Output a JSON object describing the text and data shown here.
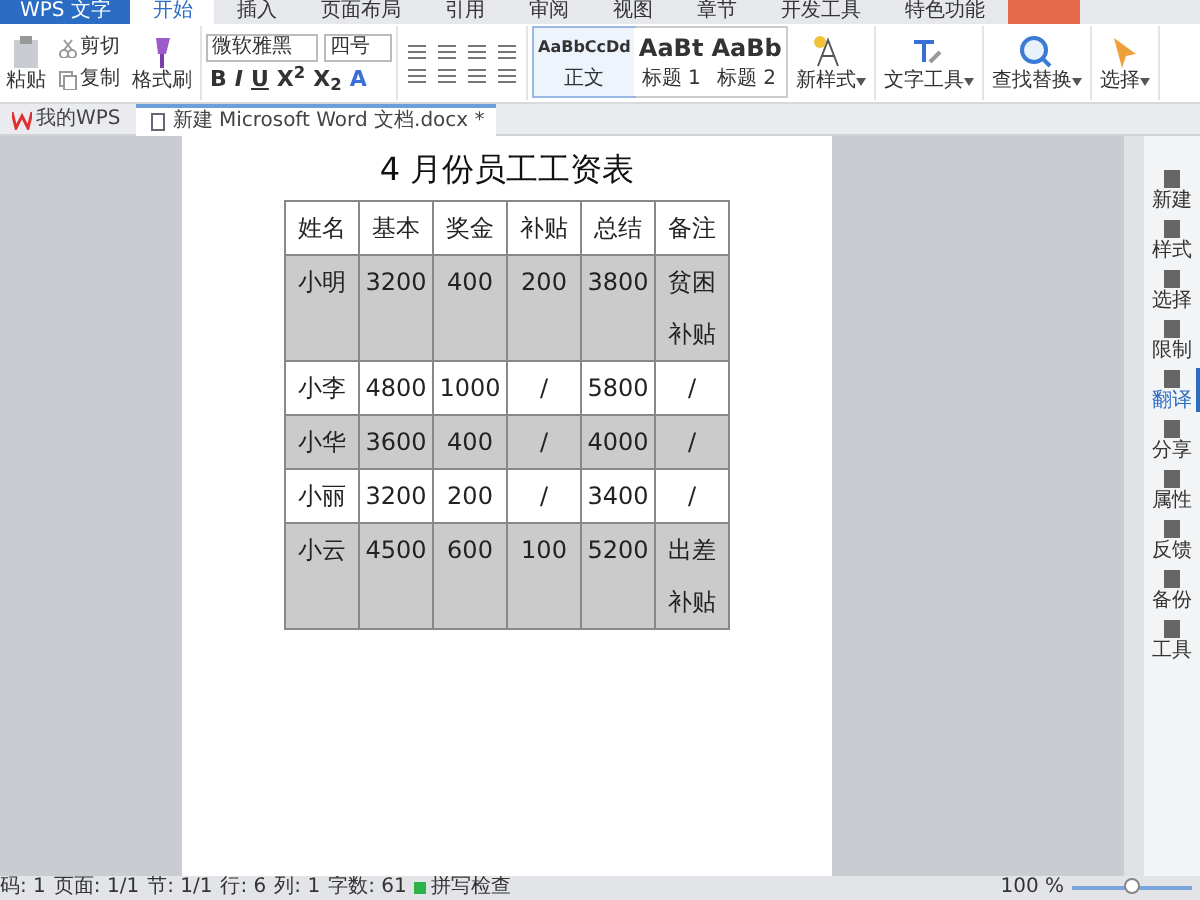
{
  "app_button": "WPS 文字",
  "menu_tabs": [
    {
      "label": "开始",
      "selected": true
    },
    {
      "label": "插入",
      "selected": false
    },
    {
      "label": "页面布局",
      "selected": false
    },
    {
      "label": "引用",
      "selected": false
    },
    {
      "label": "审阅",
      "selected": false
    },
    {
      "label": "视图",
      "selected": false
    },
    {
      "label": "章节",
      "selected": false
    },
    {
      "label": "开发工具",
      "selected": false
    },
    {
      "label": "特色功能",
      "selected": false
    }
  ],
  "ribbon": {
    "paste": "粘贴",
    "cut": "剪切",
    "copy": "复制",
    "format_painter": "格式刷",
    "font_name": "微软雅黑",
    "font_size": "四号",
    "format_buttons": [
      "B",
      "I",
      "U",
      "X$^{2}$",
      "X$_{2}$",
      "A"
    ],
    "styles": [
      {
        "preview": "AaBbCcDd",
        "label": "正文",
        "selected": true
      },
      {
        "preview": "AaBt",
        "label": "标题 1",
        "selected": false
      },
      {
        "preview": "AaBb",
        "label": "标题 2",
        "selected": false
      }
    ],
    "tools": [
      {
        "kind": "newstyle",
        "label": "新样式"
      },
      {
        "kind": "texttool",
        "label": "文字工具"
      },
      {
        "kind": "find",
        "label": "查找替换"
      },
      {
        "kind": "select",
        "label": "选择"
      }
    ]
  },
  "doc_tabs": [
    {
      "label": "我的WPS",
      "selected": false
    },
    {
      "label": "新建 Microsoft Word 文档.docx *",
      "selected": true
    }
  ],
  "document": {
    "title": "4 月份员工工资表",
    "table": {
      "columns": [
        "姓名",
        "基本",
        "奖金",
        "补贴",
        "总结",
        "备注"
      ],
      "rows": [
        {
          "shaded": true,
          "cells": [
            "小明",
            "3200",
            "400",
            "200",
            "3800",
            "贫困补贴"
          ]
        },
        {
          "shaded": false,
          "cells": [
            "小李",
            "4800",
            "1000",
            "/",
            "5800",
            "/"
          ]
        },
        {
          "shaded": true,
          "cells": [
            "小华",
            "3600",
            "400",
            "/",
            "4000",
            "/"
          ]
        },
        {
          "shaded": false,
          "cells": [
            "小丽",
            "3200",
            "200",
            "/",
            "3400",
            "/"
          ]
        },
        {
          "shaded": true,
          "cells": [
            "小云",
            "4500",
            "600",
            "100",
            "5200",
            "出差补贴"
          ]
        }
      ]
    }
  },
  "sidebar": {
    "items": [
      {
        "label": "新建",
        "selected": false
      },
      {
        "label": "样式",
        "selected": false
      },
      {
        "label": "选择",
        "selected": false
      },
      {
        "label": "限制",
        "selected": false
      },
      {
        "label": "翻译",
        "selected": true
      },
      {
        "label": "分享",
        "selected": false
      },
      {
        "label": "属性",
        "selected": false
      },
      {
        "label": "反馈",
        "selected": false
      },
      {
        "label": "备份",
        "selected": false
      },
      {
        "label": "工具",
        "selected": false
      }
    ]
  },
  "status_bar": {
    "items": [
      "码: 1",
      "页面: 1/1",
      "节: 1/1",
      "行: 6",
      "列: 1",
      "字数: 61"
    ],
    "spell_check": "拼写检查",
    "zoom": "100 %",
    "zoom_slider": {
      "level": 0.5
    }
  }
}
